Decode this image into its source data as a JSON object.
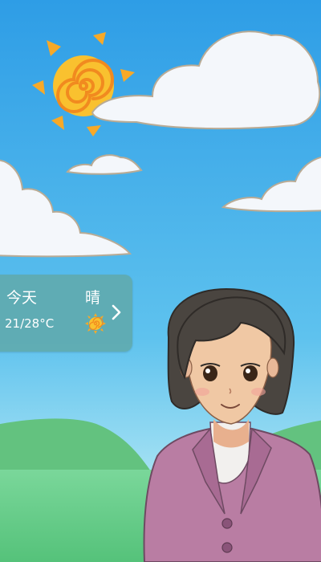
{
  "weather": {
    "day_label": "今天",
    "condition_label": "晴",
    "temp_range": "21/28°C",
    "icon": "sun-icon",
    "chevron": "chevron-right-icon"
  },
  "colors": {
    "sky_top": "#2f9fe6",
    "sky_bottom": "#9fe0f2",
    "grass": "#6fd08c",
    "card_bg": "#5faaaf",
    "jacket": "#b97da3",
    "hair": "#4a4540",
    "sun": "#f7b52f"
  }
}
